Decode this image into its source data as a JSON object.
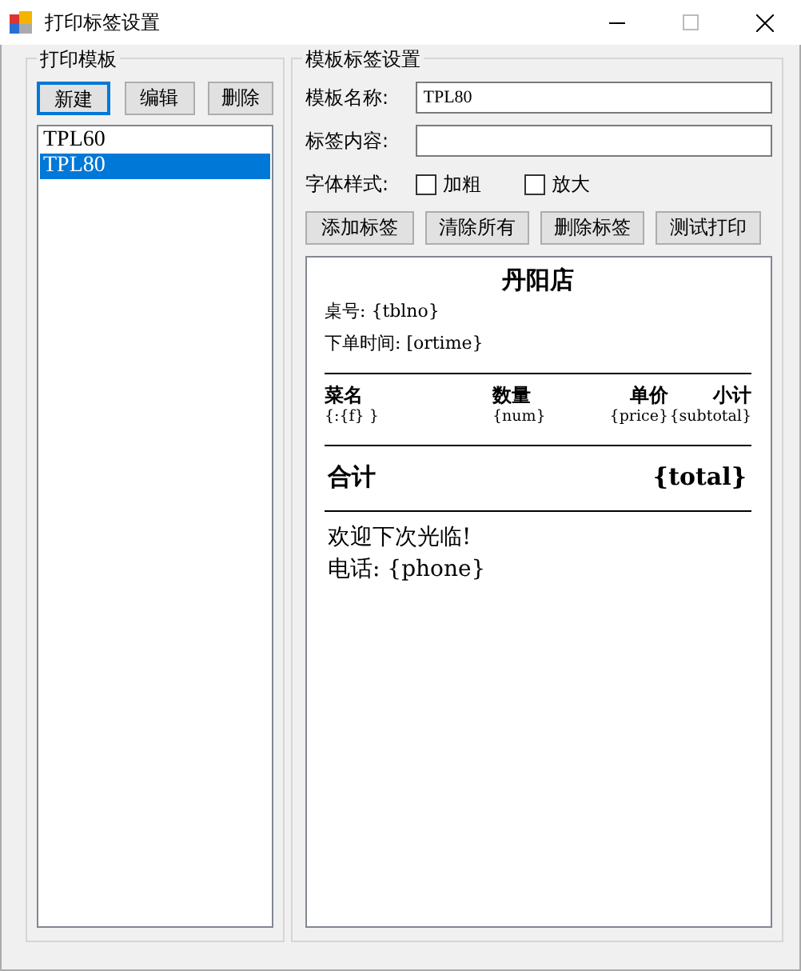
{
  "window": {
    "title": "打印标签设置"
  },
  "templates": {
    "legend": "打印模板",
    "buttons": [
      {
        "label": "新建",
        "focused": true
      },
      {
        "label": "编辑",
        "focused": false
      },
      {
        "label": "删除",
        "focused": false
      }
    ],
    "items": [
      {
        "label": "TPL60",
        "selected": false
      },
      {
        "label": "TPL80",
        "selected": true
      }
    ]
  },
  "settings": {
    "legend": "模板标签设置",
    "name_label": "模板名称:",
    "name_value": "TPL80",
    "content_label": "标签内容:",
    "style_label": "字体样式:",
    "options": [
      {
        "label": "加粗",
        "checked": false
      },
      {
        "label": "放大",
        "checked": false
      }
    ],
    "buttons": [
      "添加标签",
      "清除所有",
      "删除标签",
      "测试打印"
    ]
  },
  "preview": [
    {
      "kind": "title",
      "text": "丹阳店"
    },
    {
      "kind": "field",
      "text": "桌号: {tblno}"
    },
    {
      "kind": "field",
      "text": "下单时间: [ortime}"
    },
    {
      "kind": "rule"
    },
    {
      "kind": "columns",
      "cells": [
        "菜名",
        "数量",
        "单价",
        "小计"
      ]
    },
    {
      "kind": "values",
      "cells": [
        "{:{f} }",
        "{num}",
        "{price}",
        "{subtotal}"
      ]
    },
    {
      "kind": "rule"
    },
    {
      "kind": "total",
      "label": "合计",
      "value": "{total}"
    },
    {
      "kind": "rule"
    },
    {
      "kind": "footer",
      "text": "欢迎下次光临!"
    },
    {
      "kind": "footer",
      "text": "电话: {phone}"
    }
  ]
}
